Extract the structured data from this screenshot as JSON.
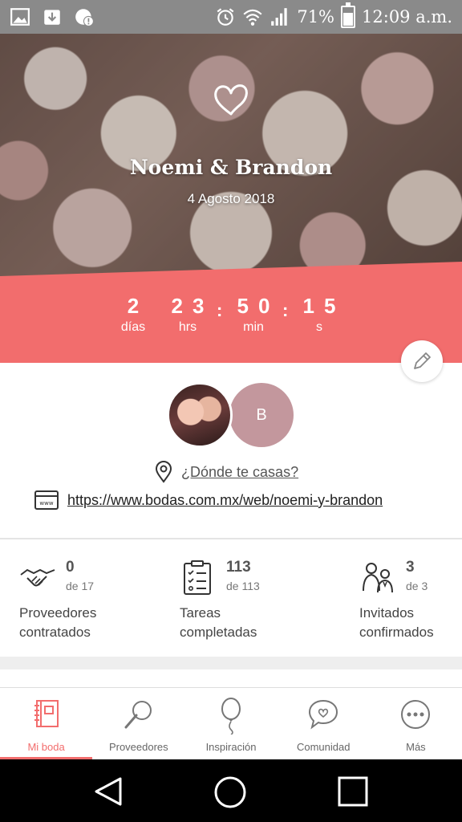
{
  "status_bar": {
    "battery": "71%",
    "time": "12:09 a.m.",
    "icons": [
      "gallery-icon",
      "download-icon",
      "sync-alert-icon",
      "alarm-icon",
      "wifi-icon",
      "signal-icon",
      "battery-icon"
    ]
  },
  "hero": {
    "icon": "heart-icon",
    "couple": "Noemi & Brandon",
    "date": "4 Agosto 2018"
  },
  "countdown": {
    "days": "2",
    "days_label": "días",
    "hours": "23",
    "hours_label": "hrs",
    "minutes": "50",
    "minutes_label": "min",
    "seconds": "15",
    "seconds_label": "s",
    "separator": ":"
  },
  "profile": {
    "avatar_initial": "B",
    "where_label": "¿Dónde te casas?",
    "website": "https://www.bodas.com.mx/web/noemi-y-brandon"
  },
  "stats": [
    {
      "count": "0",
      "of": "de 17",
      "label_line1": "Proveedores",
      "label_line2": "contratados",
      "icon": "handshake-icon"
    },
    {
      "count": "113",
      "of": "de 113",
      "label_line1": "Tareas",
      "label_line2": "completadas",
      "icon": "checklist-icon"
    },
    {
      "count": "3",
      "of": "de 3",
      "label_line1": "Invitados",
      "label_line2": "confirmados",
      "icon": "guests-icon"
    }
  ],
  "tabs": [
    {
      "label": "Mi boda",
      "icon": "planner-icon",
      "active": true
    },
    {
      "label": "Proveedores",
      "icon": "magnifier-icon",
      "active": false
    },
    {
      "label": "Inspiración",
      "icon": "balloon-icon",
      "active": false
    },
    {
      "label": "Comunidad",
      "icon": "chat-heart-icon",
      "active": false
    },
    {
      "label": "Más",
      "icon": "more-icon",
      "active": false
    }
  ],
  "colors": {
    "accent": "#f26d6d",
    "avatar_b": "#c3979d",
    "status_bar": "#8a8a8a"
  }
}
